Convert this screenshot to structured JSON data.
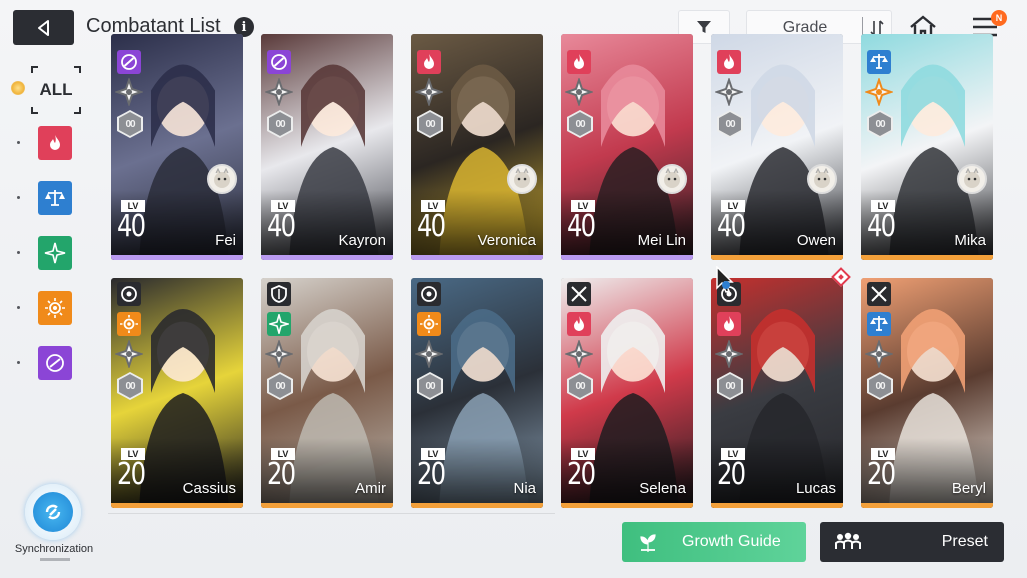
{
  "header": {
    "title": "Combatant List",
    "sort_label": "Grade",
    "notification_badge": "N"
  },
  "filters": {
    "all_label": "ALL",
    "elements": [
      {
        "name": "fire",
        "color": "#e0405a"
      },
      {
        "name": "balance",
        "color": "#2e7fd0"
      },
      {
        "name": "wind",
        "color": "#23a56b"
      },
      {
        "name": "light",
        "color": "#f08a1a"
      },
      {
        "name": "void",
        "color": "#8b45d6"
      }
    ]
  },
  "sync": {
    "label": "Synchronization"
  },
  "cards": [
    {
      "name": "Fei",
      "level": "40",
      "lv_tag": "LV",
      "element": "void",
      "elem_color": "#8b45d6",
      "star": "00",
      "underline": "#b99af0",
      "bg": [
        "#2c2f4a",
        "#6b7090",
        "#2a2d3a"
      ],
      "pet": true
    },
    {
      "name": "Kayron",
      "level": "40",
      "lv_tag": "LV",
      "element": "void",
      "elem_color": "#8b45d6",
      "star": "00",
      "underline": "#b99af0",
      "bg": [
        "#5a3a3a",
        "#e8e8ec",
        "#3a3c44"
      ],
      "pet": false
    },
    {
      "name": "Veronica",
      "level": "40",
      "lv_tag": "LV",
      "element": "fire",
      "elem_color": "#e0405a",
      "star": "00",
      "underline": "#b99af0",
      "bg": [
        "#6b5a44",
        "#2b2622",
        "#d8b430"
      ],
      "pet": true
    },
    {
      "name": "Mei Lin",
      "level": "40",
      "lv_tag": "LV",
      "element": "fire",
      "elem_color": "#e0405a",
      "star": "00",
      "underline": "#b99af0",
      "bg": [
        "#e8899a",
        "#c23a4e",
        "#2a1e22"
      ],
      "pet": true
    },
    {
      "name": "Owen",
      "level": "40",
      "lv_tag": "LV",
      "element": "fire",
      "elem_color": "#e0405a",
      "star": "00",
      "underline": "#f3a03a",
      "bg": [
        "#cfd8e6",
        "#f1f3f6",
        "#2b2d33"
      ],
      "pet": true
    },
    {
      "name": "Mika",
      "level": "40",
      "lv_tag": "LV",
      "element": "balance",
      "elem_color": "#2e7fd0",
      "star": "00",
      "underline": "#f3a03a",
      "bg": [
        "#8fdadf",
        "#f3f4f6",
        "#33353a"
      ],
      "pet": true
    },
    {
      "name": "Cassius",
      "level": "20",
      "lv_tag": "LV",
      "element": "light",
      "elem_color": "#f08a1a",
      "star": "00",
      "underline": "#f3a03a",
      "bg": [
        "#2a2a2e",
        "#e6d43a",
        "#1c1c1f"
      ],
      "pet": false
    },
    {
      "name": "Amir",
      "level": "20",
      "lv_tag": "LV",
      "element": "wind",
      "elem_color": "#23a56b",
      "star": "00",
      "underline": "#f3a03a",
      "bg": [
        "#d6d2cc",
        "#7a5a48",
        "#bdb8b0"
      ],
      "pet": false
    },
    {
      "name": "Nia",
      "level": "20",
      "lv_tag": "LV",
      "element": "light",
      "elem_color": "#f08a1a",
      "star": "00",
      "underline": "#f3a03a",
      "bg": [
        "#4a6a86",
        "#2b3038",
        "#8aa0b4"
      ],
      "pet": false
    },
    {
      "name": "Selena",
      "level": "20",
      "lv_tag": "LV",
      "element": "fire",
      "elem_color": "#e0405a",
      "star": "00",
      "underline": "#f3a03a",
      "bg": [
        "#eeeeee",
        "#d03a4a",
        "#1e1c20"
      ],
      "pet": false
    },
    {
      "name": "Lucas",
      "level": "20",
      "lv_tag": "LV",
      "element": "fire",
      "elem_color": "#e0405a",
      "star": "00",
      "underline": "#f3a03a",
      "bg": [
        "#c4302e",
        "#3a3c42",
        "#26272b"
      ],
      "pet": false
    },
    {
      "name": "Beryl",
      "level": "20",
      "lv_tag": "LV",
      "element": "balance",
      "elem_color": "#2e7fd0",
      "star": "00",
      "underline": "#f3a03a",
      "bg": [
        "#f0a074",
        "#5a3c30",
        "#e8e2da"
      ],
      "pet": false
    }
  ],
  "bottom": {
    "growth_label": "Growth Guide",
    "preset_label": "Preset"
  }
}
